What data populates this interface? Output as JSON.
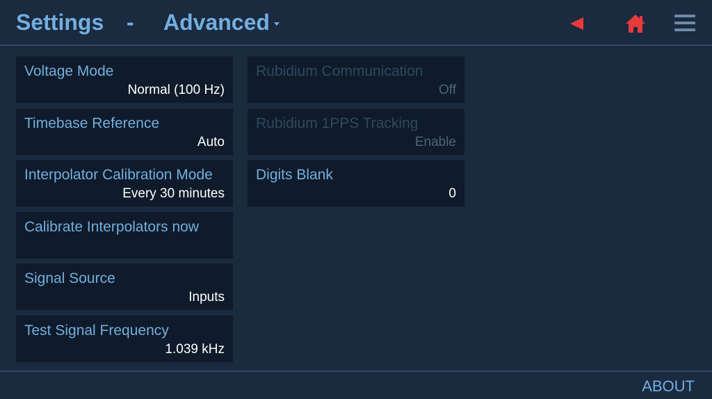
{
  "header": {
    "title": "Settings",
    "separator": "-",
    "subtitle": "Advanced"
  },
  "icons": {
    "back": "back-arrow-icon",
    "home": "home-icon",
    "menu": "hamburger-menu-icon"
  },
  "colors": {
    "accent": "#73aedf",
    "alert": "#e83a3c",
    "background": "#1a2a3f",
    "card": "#0f1b2a"
  },
  "left_column": [
    {
      "label": "Voltage Mode",
      "value": "Normal (100 Hz)"
    },
    {
      "label": "Timebase Reference",
      "value": "Auto"
    },
    {
      "label": "Interpolator Calibration Mode",
      "value": "Every 30 minutes"
    },
    {
      "label": "Calibrate Interpolators now",
      "value": ""
    },
    {
      "label": "Signal Source",
      "value": "Inputs"
    },
    {
      "label": "Test Signal Frequency",
      "value": "1.039 kHz"
    }
  ],
  "right_column": [
    {
      "label": "Rubidium Communication",
      "value": "Off",
      "enabled": false
    },
    {
      "label": "Rubidium 1PPS Tracking",
      "value": "Enable",
      "enabled": false
    },
    {
      "label": "Digits Blank",
      "value": "0",
      "enabled": true
    }
  ],
  "footer": {
    "about_label": "ABOUT"
  }
}
